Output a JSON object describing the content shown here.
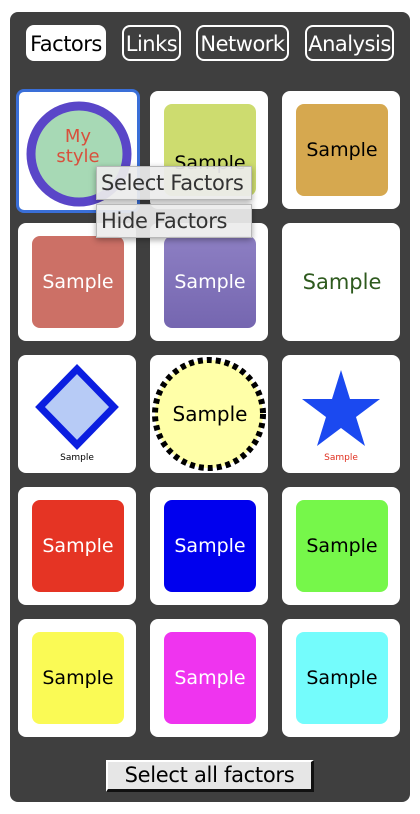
{
  "tabs": [
    {
      "label": "Factors",
      "active": true
    },
    {
      "label": "Links",
      "active": false
    },
    {
      "label": "Network",
      "active": false
    },
    {
      "label": "Analysis",
      "active": false
    }
  ],
  "styles": [
    {
      "label": "My style",
      "line1": "My",
      "line2": "style",
      "shape": "circle",
      "fill": "#a7d9b5",
      "border": "#5a46c8",
      "text_color": "#d8503c",
      "selected": true
    },
    {
      "label": "Sample",
      "shape": "rounded-box",
      "fill": "#cddc6f",
      "text_color": "#000000"
    },
    {
      "label": "Sample",
      "shape": "rounded-box",
      "fill": "#d6a84f",
      "text_color": "#000000"
    },
    {
      "label": "Sample",
      "shape": "rounded-box",
      "fill": "#cc7066",
      "text_color": "#ffffff"
    },
    {
      "label": "Sample",
      "shape": "rounded-box",
      "fill": "#7f71b6",
      "text_color": "#ffffff"
    },
    {
      "label": "Sample",
      "shape": "text-only",
      "fill": "#ffffff",
      "text_color": "#2e5a1e"
    },
    {
      "label": "Sample",
      "shape": "diamond",
      "fill": "#b7cbf6",
      "border": "#0b1ee0",
      "text_color": "#000000"
    },
    {
      "label": "Sample",
      "shape": "dashed-circle",
      "fill": "#ffffa8",
      "border": "#000000",
      "text_color": "#000000"
    },
    {
      "label": "Sample",
      "shape": "star",
      "fill": "#1b49f0",
      "text_color": "#e03020"
    },
    {
      "label": "Sample",
      "shape": "rounded-box",
      "fill": "#e53424",
      "text_color": "#ffffff"
    },
    {
      "label": "Sample",
      "shape": "rounded-box",
      "fill": "#0000ee",
      "text_color": "#ffffff"
    },
    {
      "label": "Sample",
      "shape": "rounded-box",
      "fill": "#76f74a",
      "text_color": "#000000"
    },
    {
      "label": "Sample",
      "shape": "rounded-box",
      "fill": "#fafa55",
      "text_color": "#000000"
    },
    {
      "label": "Sample",
      "shape": "rounded-box",
      "fill": "#ef34ef",
      "text_color": "#ffffff"
    },
    {
      "label": "Sample",
      "shape": "rounded-box",
      "fill": "#74fcfc",
      "text_color": "#000000"
    }
  ],
  "context_menu": {
    "items": [
      "Select Factors",
      "Hide Factors"
    ]
  },
  "select_all_label": "Select all factors"
}
